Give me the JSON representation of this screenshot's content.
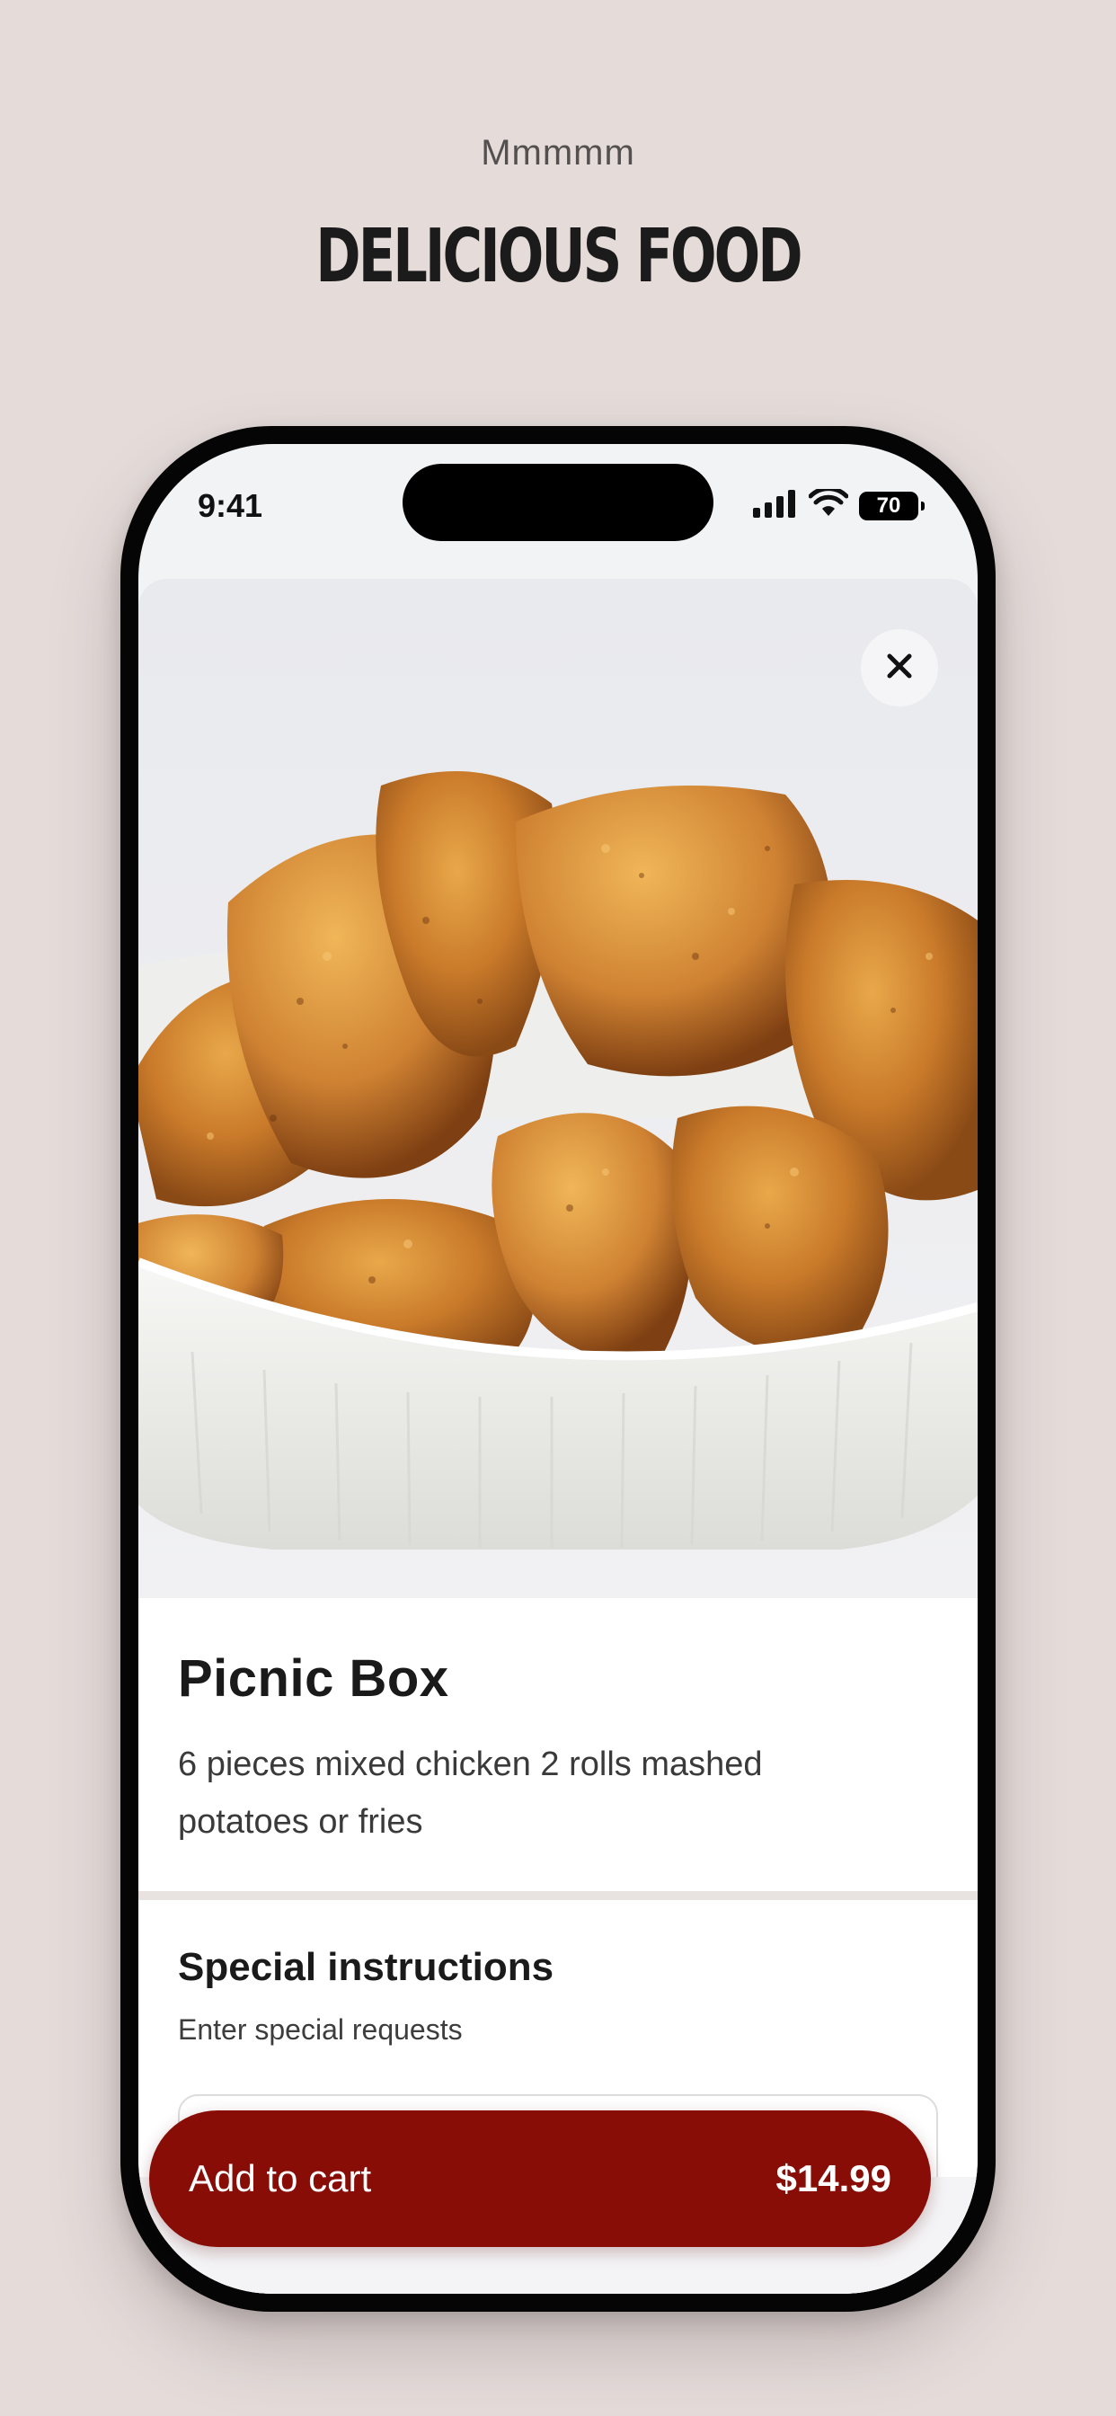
{
  "promo": {
    "subtitle": "Mmmmm",
    "title": "DELICIOUS FOOD"
  },
  "status_bar": {
    "time": "9:41",
    "battery": "70",
    "icons": [
      "cellular-signal-icon",
      "wifi-icon",
      "battery-icon"
    ]
  },
  "item": {
    "image": "fried-chicken-in-white-dish",
    "title": "Picnic Box",
    "description": "6 pieces mixed chicken 2 rolls mashed potatoes or fries"
  },
  "special_instructions": {
    "title": "Special instructions",
    "subtitle": "Enter special requests",
    "value": ""
  },
  "cart_button": {
    "label": "Add to cart",
    "price": "$14.99"
  },
  "colors": {
    "background": "#e5dcda",
    "accent": "#890d07"
  }
}
